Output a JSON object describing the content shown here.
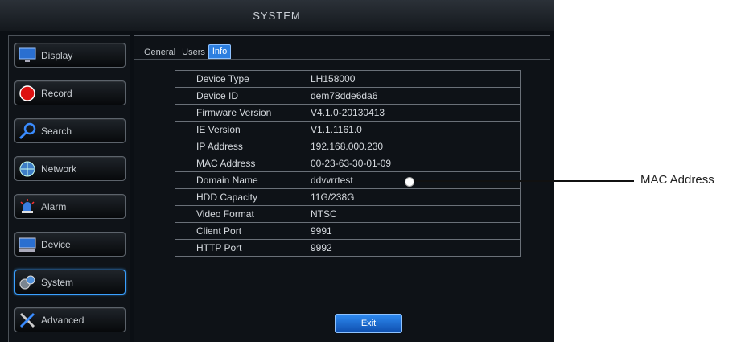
{
  "window": {
    "title": "SYSTEM"
  },
  "sidebar": {
    "items": [
      {
        "label": "Display",
        "icon": "monitor-icon"
      },
      {
        "label": "Record",
        "icon": "record-icon"
      },
      {
        "label": "Search",
        "icon": "search-icon"
      },
      {
        "label": "Network",
        "icon": "network-icon"
      },
      {
        "label": "Alarm",
        "icon": "alarm-icon"
      },
      {
        "label": "Device",
        "icon": "device-icon"
      },
      {
        "label": "System",
        "icon": "system-icon"
      },
      {
        "label": "Advanced",
        "icon": "tools-icon"
      }
    ],
    "active": "System"
  },
  "tabs": [
    {
      "label": "General"
    },
    {
      "label": "Users"
    },
    {
      "label": "Info"
    }
  ],
  "active_tab": "Info",
  "info": {
    "rows": [
      {
        "label": "Device Type",
        "value": "LH158000"
      },
      {
        "label": "Device ID",
        "value": "dem78dde6da6"
      },
      {
        "label": "Firmware Version",
        "value": "V4.1.0-20130413"
      },
      {
        "label": "IE Version",
        "value": "V1.1.1161.0"
      },
      {
        "label": "IP Address",
        "value": "192.168.000.230"
      },
      {
        "label": "MAC Address",
        "value": "00-23-63-30-01-09"
      },
      {
        "label": "Domain Name",
        "value": "ddvvrrtest"
      },
      {
        "label": "HDD Capacity",
        "value": "11G/238G"
      },
      {
        "label": "Video Format",
        "value": "NTSC"
      },
      {
        "label": "Client Port",
        "value": "9991"
      },
      {
        "label": "HTTP Port",
        "value": "9992"
      }
    ]
  },
  "buttons": {
    "exit_label": "Exit"
  },
  "callout": {
    "label": "MAC Address"
  },
  "colors": {
    "accent": "#2d7fe0",
    "active_border": "#3aa0ff"
  }
}
